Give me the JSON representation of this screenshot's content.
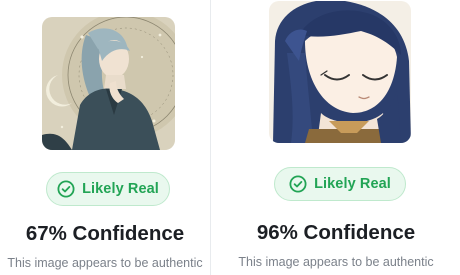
{
  "results": [
    {
      "image_alt": "anime illustration of a silver-haired man against a starry moon",
      "badge_icon": "check-circle-icon",
      "badge_label": "Likely Real",
      "confidence": "67% Confidence",
      "description": "This image appears to be authentic"
    },
    {
      "image_alt": "anime girl with long dark blue hair, eyes closed",
      "badge_icon": "check-circle-icon",
      "badge_label": "Likely Real",
      "confidence": "96% Confidence",
      "description": "This image appears to be authentic"
    }
  ],
  "colors": {
    "badge_bg": "#e9f8ee",
    "badge_border": "#bfe9cd",
    "badge_text": "#22a455",
    "confidence_text": "#1c1f24",
    "description_text": "#7b818a"
  }
}
